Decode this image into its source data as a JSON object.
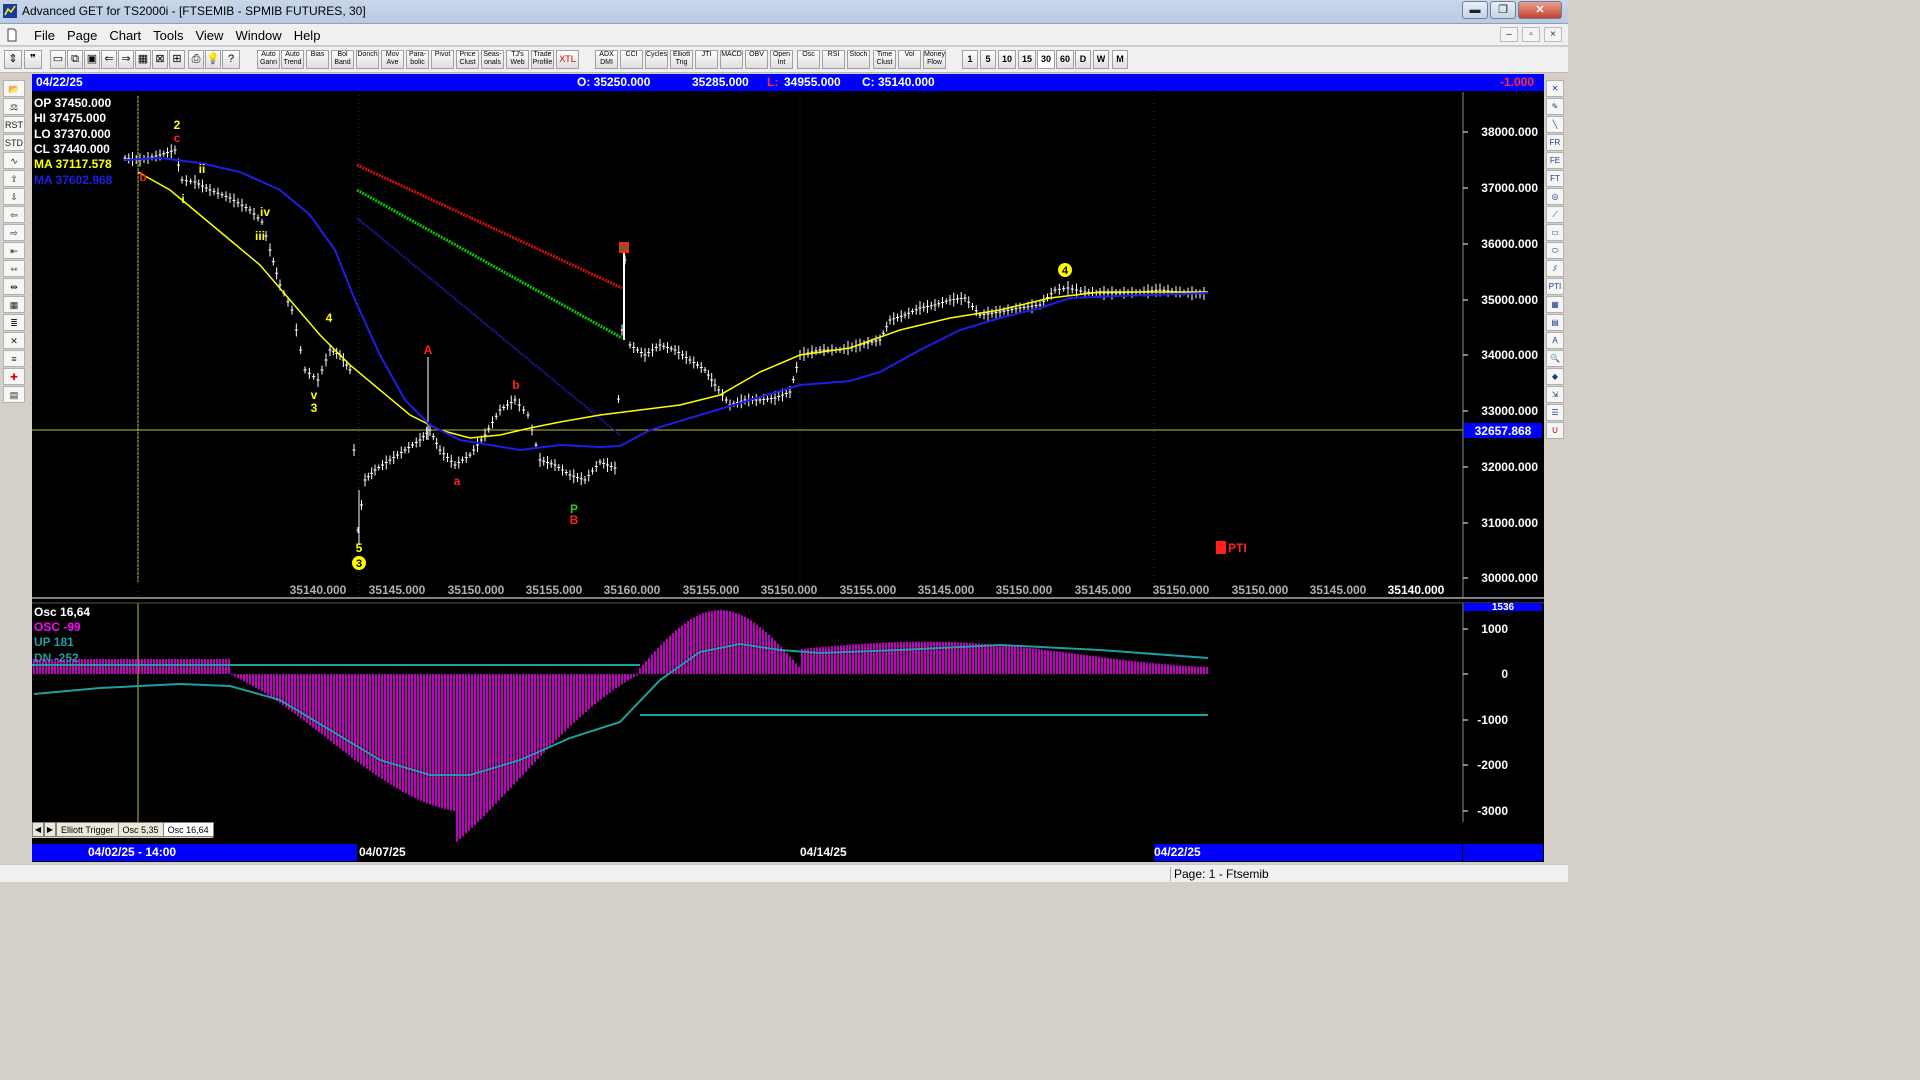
{
  "window": {
    "title": "Advanced GET for TS2000i - [FTSEMIB - SPMIB FUTURES, 30]",
    "minimize_label": "▬",
    "maximize_label": "❐",
    "close_label": "✕"
  },
  "menu": [
    "File",
    "Page",
    "Chart",
    "Tools",
    "View",
    "Window",
    "Help"
  ],
  "toolbar": {
    "buttons": [
      "Auto Gann",
      "Auto Trend",
      "Bias",
      "Bol Band",
      "Donch",
      "Mov Ave",
      "Para-bolic",
      "Pivot",
      "Price Clust",
      "Seas-onals",
      "TJ's Web",
      "Trade Profile",
      "XTL",
      "ADX DMI",
      "CCI",
      "Cycles",
      "Elliott Trig",
      "JTI",
      "MACD",
      "OBV",
      "Open Int",
      "Osc",
      "RSI",
      "Stoch",
      "Time Clust",
      "Vol",
      "Money Flow"
    ],
    "intervals": [
      "1",
      "5",
      "10",
      "15",
      "30",
      "60",
      "D",
      "W",
      "M"
    ],
    "active_interval": "30"
  },
  "info_bar": {
    "date": "04/22/25",
    "open": "O: 35250.000",
    "high": "35285.000",
    "low_label": "L:",
    "low": "34955.000",
    "close": "C: 35140.000",
    "change": "-1.000"
  },
  "legend": {
    "op": "OP  37450.000",
    "hi": "HI   37475.000",
    "lo": "LO  37370.000",
    "cl": "CL  37440.000",
    "ma1": "MA  37117.578",
    "ma2": "MA  37602.968"
  },
  "price_axis": {
    "labels": [
      "38000.000",
      "37000.000",
      "36000.000",
      "35000.000",
      "34000.000",
      "33000.000",
      "32000.000",
      "31000.000",
      "30000.000"
    ],
    "cursor_value": "32657.868"
  },
  "bottom_price_labels": [
    "35140.000",
    "35145.000",
    "35150.000",
    "35155.000",
    "35160.000",
    "35155.000",
    "35150.000",
    "35155.000",
    "35145.000",
    "35150.000",
    "35145.000",
    "35150.000",
    "35150.000",
    "35145.000",
    "35140.000"
  ],
  "wave_labels": {
    "w2": "2",
    "wc_top": "c",
    "wb_left": "b",
    "wii": "ii",
    "wi": "i",
    "wiv": "iv",
    "wiii": "iii",
    "w4a": "4",
    "wv": "v",
    "w3": "3",
    "wA": "A",
    "wa": "a",
    "wb": "b",
    "wP1": "P",
    "wP2": "P",
    "wB2": "B",
    "w5": "5",
    "w3c": "3",
    "w4c": "4",
    "pti": "PTI"
  },
  "osc_legend": {
    "title": "Osc 16,64",
    "osc": "OSC -99",
    "up": "UP   181",
    "dn": "DN   -252"
  },
  "osc_axis": {
    "labels": [
      "1000",
      "0",
      "-1000",
      "-2000",
      "-3000"
    ],
    "top_label": "1536"
  },
  "tabs": [
    "Elliott Trigger",
    "Osc 5,35",
    "Osc 16,64"
  ],
  "active_tab": "Osc 16,64",
  "date_axis": [
    "04/02/25 - 14:00",
    "04/07/25",
    "04/14/25",
    "04/22/25"
  ],
  "status": {
    "page": "Page: 1 - Ftsemib"
  },
  "colors": {
    "ma_yellow": "#ffff00",
    "ma_blue": "#1e1ee6",
    "osc_magenta": "#ff00ff",
    "osc_teal": "#1f9e9e",
    "wave_red": "#ff2020",
    "info_blue": "#0000ff"
  }
}
